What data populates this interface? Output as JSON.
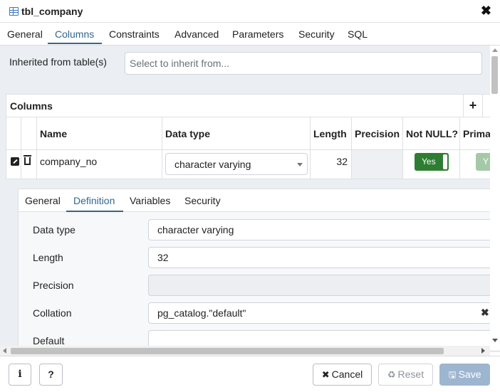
{
  "window": {
    "title": "tbl_company",
    "table_icon": "table-icon",
    "close_icon": "close-icon"
  },
  "tabs": [
    {
      "label": "General"
    },
    {
      "label": "Columns",
      "active": true
    },
    {
      "label": "Constraints"
    },
    {
      "label": "Advanced"
    },
    {
      "label": "Parameters"
    },
    {
      "label": "Security"
    },
    {
      "label": "SQL"
    }
  ],
  "inherit": {
    "label": "Inherited from table(s)",
    "placeholder": "Select to inherit from..."
  },
  "columns": {
    "title": "Columns",
    "add_icon": "plus-icon",
    "headers": [
      "Name",
      "Data type",
      "Length",
      "Precision",
      "Not NULL?",
      "Prima"
    ],
    "row": {
      "name": "company_no",
      "data_type": "character varying",
      "length": "32",
      "precision": "",
      "not_null": "Yes",
      "primary_key": "Y",
      "edit_icon": "edit-icon",
      "delete_icon": "trash-icon"
    }
  },
  "subtabs": [
    {
      "label": "General"
    },
    {
      "label": "Definition",
      "active": true
    },
    {
      "label": "Variables"
    },
    {
      "label": "Security"
    }
  ],
  "definition": {
    "fields": [
      {
        "label": "Data type",
        "value": "character varying"
      },
      {
        "label": "Length",
        "value": "32"
      },
      {
        "label": "Precision",
        "value": "",
        "disabled": true
      },
      {
        "label": "Collation",
        "value": "pg_catalog.\"default\"",
        "clearable": true
      },
      {
        "label": "Default",
        "value": ""
      }
    ]
  },
  "footer": {
    "info_label": "i",
    "help_label": "?",
    "cancel_label": "Cancel",
    "reset_label": "Reset",
    "save_label": "Save"
  },
  "colors": {
    "accent": "#326690",
    "toggle_on": "#2e7d32",
    "save_bg": "#9db6cf",
    "content_bg": "#ebeef3"
  }
}
